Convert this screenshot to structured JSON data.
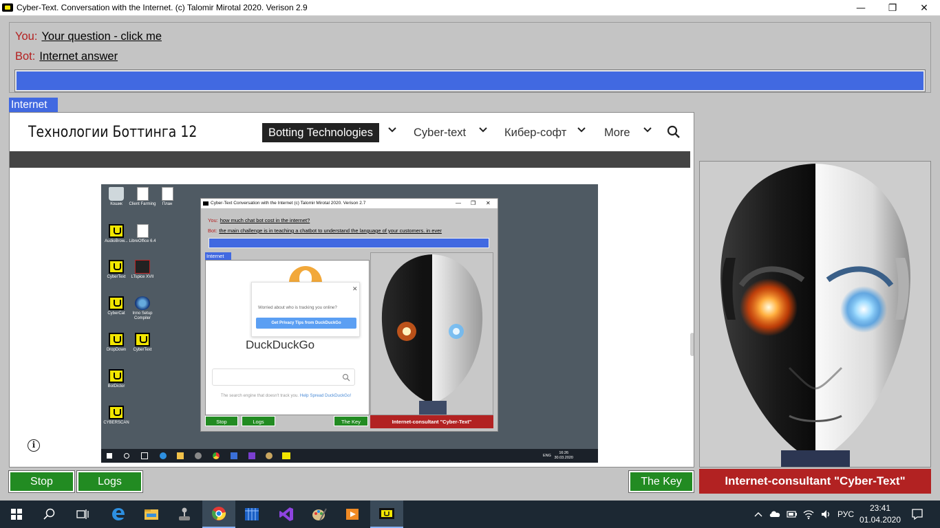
{
  "window": {
    "title": "Cyber-Text. Conversation with the Internet. (c) Talomir Mirotal 2020. Verison 2.9",
    "minimize_glyph": "—",
    "restore_glyph": "❐",
    "close_glyph": "✕"
  },
  "chat": {
    "you_prefix": "You:",
    "you_text": "Your question - click me",
    "bot_prefix": "Bot:",
    "bot_text": "Internet answer"
  },
  "internet_tab": "Internet",
  "site": {
    "title": "Технологии Боттинга 12",
    "nav": [
      "Botting Technologies",
      "Cyber-text",
      "Кибер-софт",
      "More"
    ],
    "info_glyph": "i"
  },
  "embedded": {
    "desktop_icons": [
      {
        "label": "Кошик",
        "icon": "recycle-bin-icon"
      },
      {
        "label": "Client Farming",
        "icon": "document-icon"
      },
      {
        "label": "План",
        "icon": "document-icon"
      },
      {
        "label": "AudioBrow...",
        "icon": "cybertext-icon"
      },
      {
        "label": "LibreOffice 6.4",
        "icon": "document-icon"
      },
      {
        "label": "CyberText",
        "icon": "cybertext-icon"
      },
      {
        "label": "LTspice XVII",
        "icon": "ltspice-icon"
      },
      {
        "label": "CyberCat",
        "icon": "cybertext-icon"
      },
      {
        "label": "Inno Setup Compiler",
        "icon": "inno-setup-icon"
      },
      {
        "label": "DropDown",
        "icon": "cybertext-icon"
      },
      {
        "label": "CyberText",
        "icon": "cybertext-icon"
      },
      {
        "label": "BotDictor",
        "icon": "cybertext-icon"
      },
      {
        "label": "CYBERSCAN",
        "icon": "cybertext-icon"
      }
    ],
    "window_title": "Cyber-Text Conversation with the Internet (c) Talomir Mirotal 2020. Verison 2.7",
    "you_prefix": "You:",
    "you_text": "how much chat bot cost in the internet?",
    "bot_prefix": "Bot:",
    "bot_text": "the main challenge is in teaching a chatbot to understand the language of your customers. in ever",
    "internet_tab": "Internet",
    "ddg_popup_text": "Worried about who is tracking you online?",
    "ddg_popup_button": "Get Privacy Tips from DuckDuckGo",
    "ddg_name": "DuckDuckGo",
    "ddg_tagline": "The search engine that doesn't track you.",
    "ddg_tagline_link": "Help Spread DuckDuckGo!",
    "stop": "Stop",
    "logs": "Logs",
    "key": "The Key",
    "consultant": "Internet-consultant \"Cyber-Text\"",
    "tray_lang": "ENG",
    "tray_time": "16:26",
    "tray_date": "30.03.2020"
  },
  "buttons": {
    "stop": "Stop",
    "logs": "Logs",
    "key": "The Key"
  },
  "consultant_label": "Internet-consultant \"Cyber-Text\"",
  "taskbar": {
    "apps": [
      "start-icon",
      "search-icon",
      "task-view-icon",
      "edge-icon",
      "file-explorer-icon",
      "joystick-icon",
      "chrome-icon",
      "app-grid-icon",
      "visual-studio-icon",
      "paint-icon",
      "media-player-icon",
      "cybertext-icon"
    ],
    "lang": "РУС",
    "time": "23:41",
    "date": "01.04.2020"
  },
  "colors": {
    "accent_blue": "#4169e1",
    "button_green": "#228b22",
    "consultant_red": "#b22222",
    "prefix_red": "#b41e1e"
  }
}
